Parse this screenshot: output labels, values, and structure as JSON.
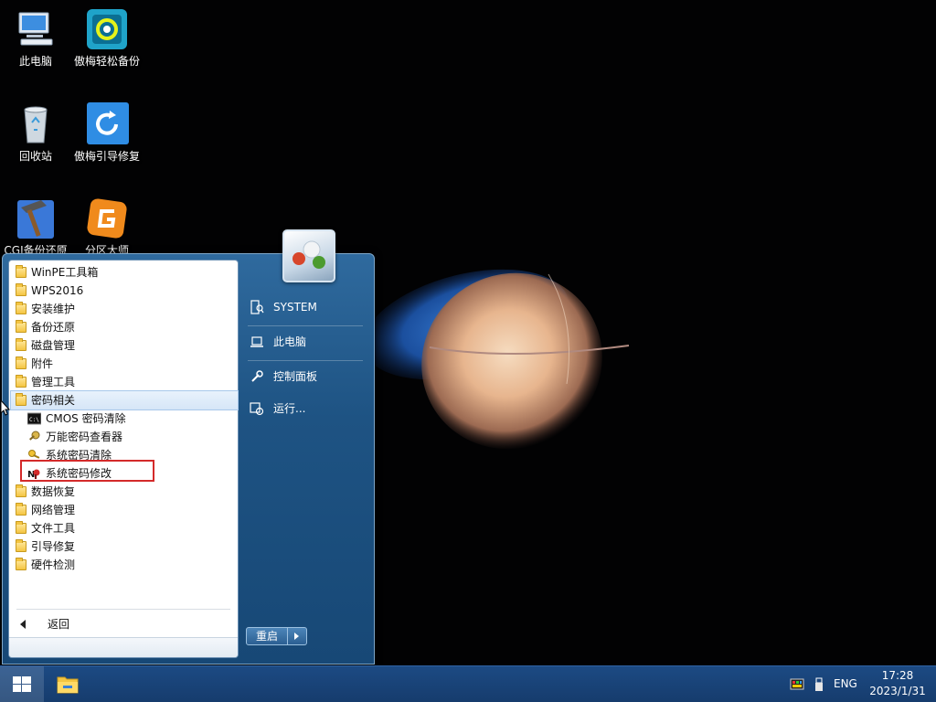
{
  "desktop": {
    "icons": [
      {
        "label": "此电脑"
      },
      {
        "label": "傲梅轻松备份"
      },
      {
        "label": "回收站"
      },
      {
        "label": "傲梅引导修复"
      },
      {
        "label": "CGI备份还原"
      },
      {
        "label": "分区大师"
      }
    ]
  },
  "start_menu": {
    "programs": [
      {
        "label": "WinPE工具箱"
      },
      {
        "label": "WPS2016"
      },
      {
        "label": "安装维护"
      },
      {
        "label": "备份还原"
      },
      {
        "label": "磁盘管理"
      },
      {
        "label": "附件"
      },
      {
        "label": "管理工具"
      },
      {
        "label": "密码相关"
      },
      {
        "label": "CMOS 密码清除"
      },
      {
        "label": "万能密码查看器"
      },
      {
        "label": "系统密码清除"
      },
      {
        "label": "系统密码修改"
      },
      {
        "label": "数据恢复"
      },
      {
        "label": "网络管理"
      },
      {
        "label": "文件工具"
      },
      {
        "label": "引导修复"
      },
      {
        "label": "硬件检测"
      }
    ],
    "back_label": "返回",
    "right": {
      "user": "SYSTEM",
      "computer": "此电脑",
      "control_panel": "控制面板",
      "run": "运行..."
    },
    "restart_label": "重启"
  },
  "taskbar": {
    "language": "ENG",
    "time": "17:28",
    "date": "2023/1/31"
  },
  "colors": {
    "accent": "#1c4a83",
    "highlight_box": "#d42a2a"
  }
}
